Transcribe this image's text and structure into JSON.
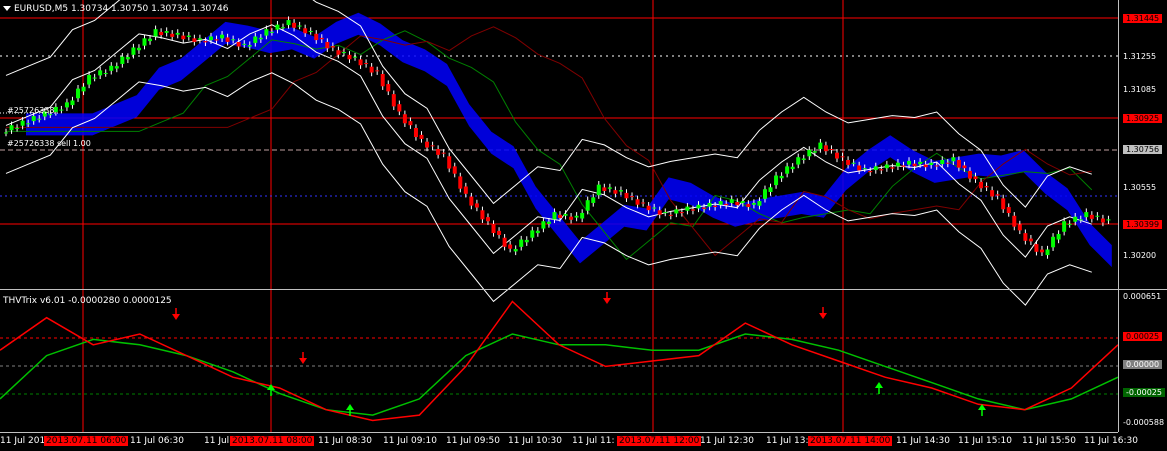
{
  "chart_title": "EURUSD,M5  1.30734 1.30750 1.30734 1.30746",
  "indicator_title": "THVTrix v6.01 -0.0000280 0.0000125",
  "orders": [
    {
      "label": "#25726338"
    },
    {
      "label": "#25726338 sell 1.00"
    }
  ],
  "price_axis": {
    "labels": [
      "1.31445",
      "1.31255",
      "1.31085",
      "1.30925",
      "1.30756",
      "1.30555",
      "1.30399",
      "1.30200"
    ],
    "highlighted": [
      "1.31445",
      "1.30925",
      "1.30399"
    ],
    "boxed_gray": [
      "1.30756"
    ]
  },
  "indicator_axis": {
    "labels": [
      "0.000651",
      "0.00025",
      "0.00000",
      "-0.00025",
      "-0.000588"
    ],
    "boxed": {
      "0.00025": "#ff0000",
      "0.00000": "#808080",
      "-0.00025": "#006400"
    }
  },
  "time_axis": {
    "labels": [
      "11 Jul 2013",
      "2013.07.11 06:00",
      "11 Jul 06:30",
      "11 Jul 07:",
      "2013.07.11 08:00",
      "11 Jul 08:30",
      "11 Jul 09:10",
      "11 Jul 09:50",
      "11 Jul 10:30",
      "11 Jul 11:",
      "2013.07.11 12:00",
      "11 Jul 12:30",
      "11 Jul 13:",
      "2013.07.11 14:00",
      "11 Jul 14:30",
      "11 Jul 15:10",
      "11 Jul 15:50",
      "11 Jul 16:30"
    ],
    "highlighted": [
      "2013.07.11 06:00",
      "2013.07.11 08:00",
      "2013.07.11 12:00",
      "2013.07.11 14:00"
    ]
  },
  "colors": {
    "bull": "#00ff00",
    "bear": "#ff0000",
    "grid": "#ff0000",
    "bands": "#ffffff",
    "cloud": "#0000ff",
    "trix_fast": "#ff0000",
    "trix_slow": "#00c000",
    "ma_green": "#008000",
    "ma_red": "#800000"
  },
  "chart_data": {
    "type": "line",
    "price_range": [
      1.3,
      1.3152
    ],
    "close_series": [
      1.309,
      1.3095,
      1.31,
      1.3115,
      1.312,
      1.313,
      1.314,
      1.3138,
      1.3135,
      1.3137,
      1.3132,
      1.314,
      1.3145,
      1.3139,
      1.313,
      1.3125,
      1.3117,
      1.3095,
      1.308,
      1.3072,
      1.305,
      1.3035,
      1.302,
      1.303,
      1.304,
      1.3038,
      1.3055,
      1.3052,
      1.3045,
      1.304,
      1.3043,
      1.3045,
      1.3047,
      1.3045,
      1.306,
      1.307,
      1.3078,
      1.307,
      1.3064,
      1.3066,
      1.3068,
      1.3067,
      1.307,
      1.3058,
      1.3049,
      1.303,
      1.3018,
      1.3035,
      1.304,
      1.3036
    ],
    "trix_fast": [
      0.00015,
      0.00045,
      0.0002,
      0.0003,
      0.0001,
      -0.0001,
      -0.0002,
      -0.0004,
      -0.0005,
      -0.00045,
      0.0,
      0.0006,
      0.0002,
      0.0,
      5e-05,
      0.0001,
      0.0004,
      0.0002,
      5e-05,
      -0.0001,
      -0.0002,
      -0.00035,
      -0.0004,
      -0.0002,
      0.0002
    ],
    "trix_slow": [
      -0.0003,
      0.0001,
      0.00025,
      0.0002,
      0.0001,
      -5e-05,
      -0.00025,
      -0.0004,
      -0.00045,
      -0.0003,
      0.0001,
      0.0003,
      0.0002,
      0.0002,
      0.00015,
      0.00015,
      0.0003,
      0.00025,
      0.00015,
      0.0,
      -0.00015,
      -0.0003,
      -0.0004,
      -0.0003,
      -0.0001
    ]
  }
}
